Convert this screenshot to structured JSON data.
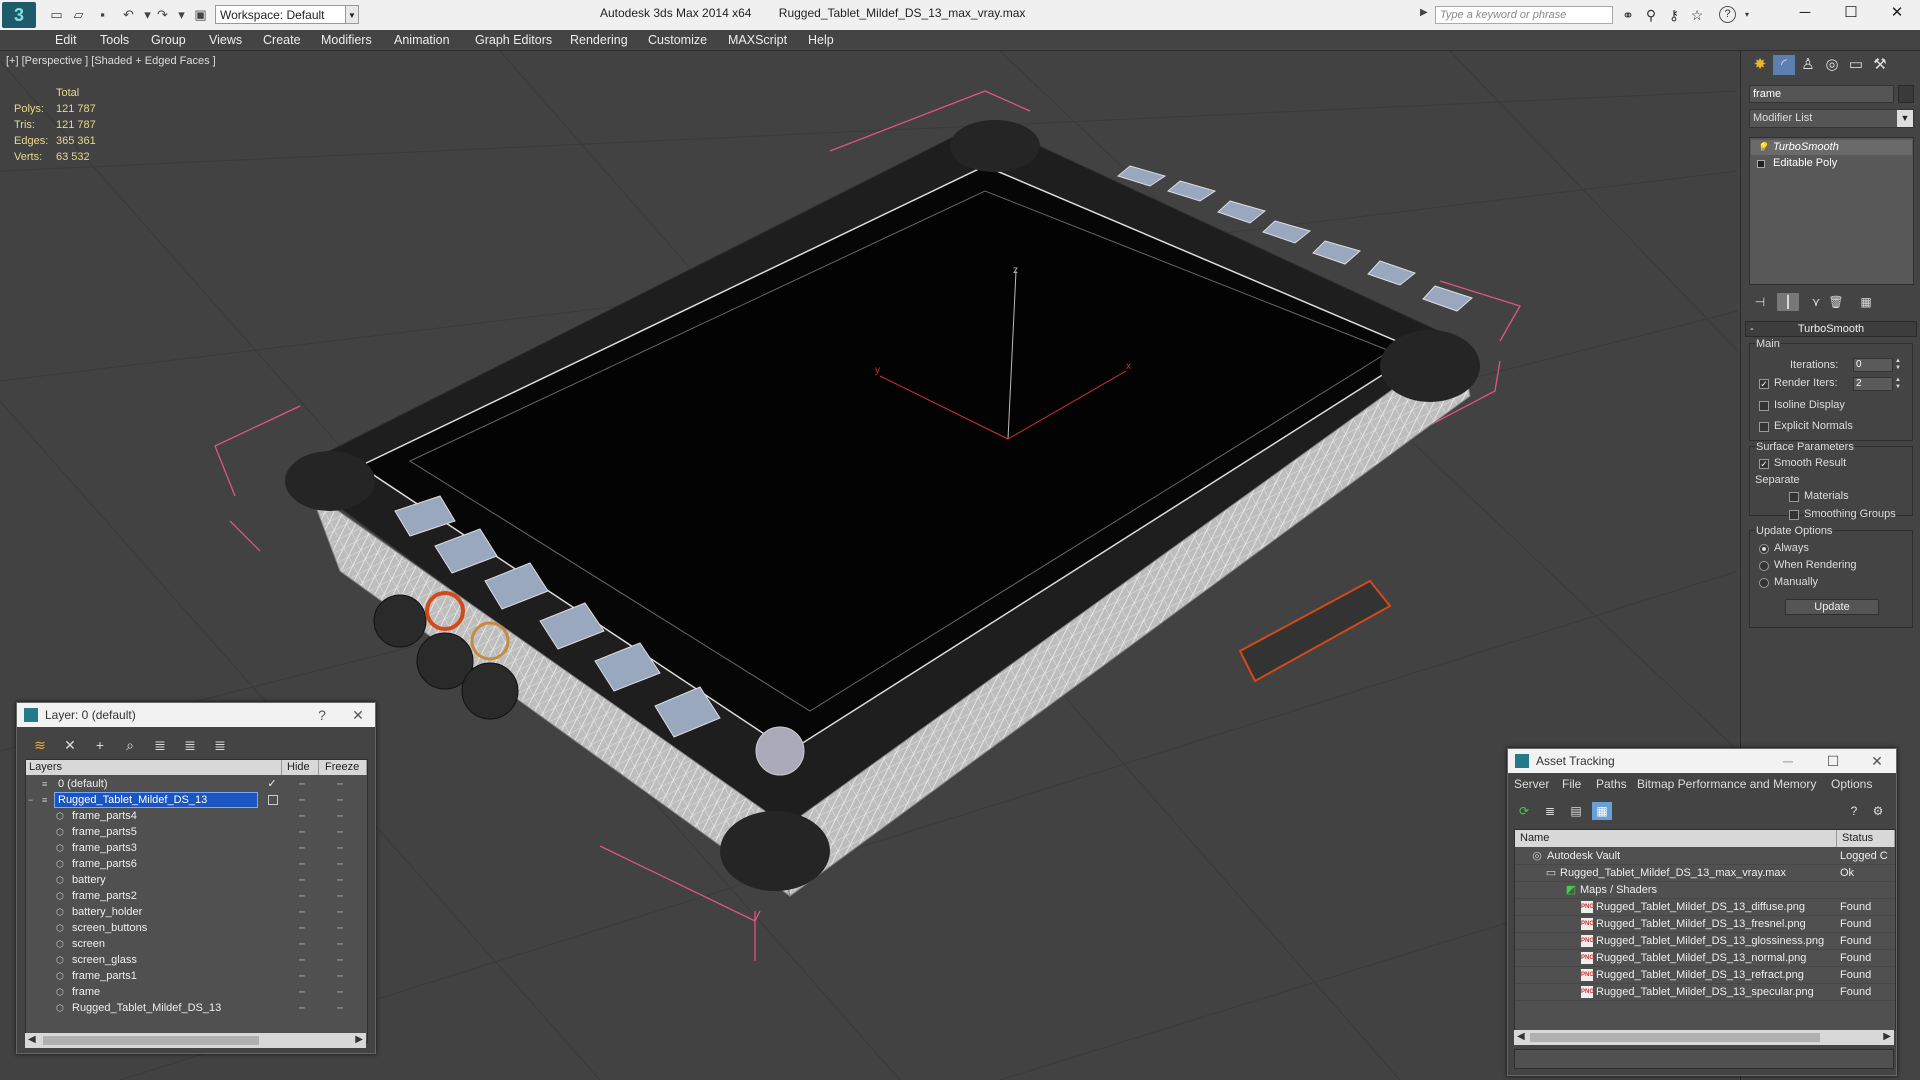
{
  "titlebar": {
    "app_name": "Autodesk 3ds Max  2014 x64",
    "file_name": "Rugged_Tablet_Mildef_DS_13_max_vray.max",
    "workspace": "Workspace: Default",
    "search_placeholder": "Type a keyword or phrase",
    "logo_glyph": "3",
    "help_glyph": "?",
    "minimize_glyph": "─",
    "maximize_glyph": "☐",
    "close_glyph": "✕"
  },
  "menu": [
    "Edit",
    "Tools",
    "Group",
    "Views",
    "Create",
    "Modifiers",
    "Animation",
    "Graph Editors",
    "Rendering",
    "Customize",
    "MAXScript",
    "Help"
  ],
  "viewport": {
    "label": "[+] [Perspective ] [Shaded + Edged Faces ]",
    "stats": {
      "header": "Total",
      "rows": [
        {
          "label": "Polys:",
          "value": "121 787"
        },
        {
          "label": "Tris:",
          "value": "121 787"
        },
        {
          "label": "Edges:",
          "value": "365 361"
        },
        {
          "label": "Verts:",
          "value": "63 532"
        }
      ]
    },
    "gizmo": {
      "x": "x",
      "y": "y",
      "z": "z"
    }
  },
  "command_panel": {
    "object_name": "frame",
    "modifier_list": "Modifier List",
    "stack": [
      {
        "label": "TurboSmooth",
        "selected": true
      },
      {
        "label": "Editable Poly",
        "selected": false
      }
    ],
    "rollout_title": "TurboSmooth",
    "main_label": "Main",
    "iterations_label": "Iterations:",
    "iterations_value": "0",
    "render_iters_label": "Render Iters:",
    "render_iters_value": "2",
    "isoline_label": "Isoline Display",
    "explicit_normals_label": "Explicit Normals",
    "surface_params_label": "Surface Parameters",
    "smooth_result_label": "Smooth Result",
    "separate_label": "Separate",
    "materials_label": "Materials",
    "smoothing_groups_label": "Smoothing Groups",
    "update_options_label": "Update Options",
    "always_label": "Always",
    "when_rendering_label": "When Rendering",
    "manually_label": "Manually",
    "update_button": "Update",
    "check_glyph": "✓"
  },
  "layer_window": {
    "title": "Layer: 0 (default)",
    "help_glyph": "?",
    "close_glyph": "✕",
    "columns": {
      "layers": "Layers",
      "hide": "Hide",
      "freeze": "Freeze"
    },
    "rows": [
      {
        "name": "0 (default)",
        "level": 1,
        "type": "layer",
        "selected": false
      },
      {
        "name": "Rugged_Tablet_Mildef_DS_13",
        "level": 1,
        "type": "layer",
        "selected": true
      },
      {
        "name": "frame_parts4",
        "level": 2,
        "type": "object",
        "selected": false
      },
      {
        "name": "frame_parts5",
        "level": 2,
        "type": "object",
        "selected": false
      },
      {
        "name": "frame_parts3",
        "level": 2,
        "type": "object",
        "selected": false
      },
      {
        "name": "frame_parts6",
        "level": 2,
        "type": "object",
        "selected": false
      },
      {
        "name": "battery",
        "level": 2,
        "type": "object",
        "selected": false
      },
      {
        "name": "frame_parts2",
        "level": 2,
        "type": "object",
        "selected": false
      },
      {
        "name": "battery_holder",
        "level": 2,
        "type": "object",
        "selected": false
      },
      {
        "name": "screen_buttons",
        "level": 2,
        "type": "object",
        "selected": false
      },
      {
        "name": "screen",
        "level": 2,
        "type": "object",
        "selected": false
      },
      {
        "name": "screen_glass",
        "level": 2,
        "type": "object",
        "selected": false
      },
      {
        "name": "frame_parts1",
        "level": 2,
        "type": "object",
        "selected": false
      },
      {
        "name": "frame",
        "level": 2,
        "type": "object",
        "selected": false
      },
      {
        "name": "Rugged_Tablet_Mildef_DS_13",
        "level": 2,
        "type": "object",
        "selected": false
      }
    ]
  },
  "asset_window": {
    "title": "Asset Tracking",
    "minimize_glyph": "─",
    "maximize_glyph": "☐",
    "close_glyph": "✕",
    "menu": [
      "Server",
      "File",
      "Paths",
      "Bitmap Performance and Memory",
      "Options"
    ],
    "columns": {
      "name": "Name",
      "status": "Status"
    },
    "rows": [
      {
        "name": "Autodesk Vault",
        "status": "Logged C",
        "level": 1,
        "icon": "vault",
        "icon_label": "◎"
      },
      {
        "name": "Rugged_Tablet_Mildef_DS_13_max_vray.max",
        "status": "Ok",
        "level": 2,
        "icon": "file",
        "icon_label": "▭"
      },
      {
        "name": "Maps / Shaders",
        "status": "",
        "level": 3,
        "icon": "maps",
        "icon_label": "◩"
      },
      {
        "name": "Rugged_Tablet_Mildef_DS_13_diffuse.png",
        "status": "Found",
        "level": 4,
        "icon": "png",
        "icon_label": "PNG"
      },
      {
        "name": "Rugged_Tablet_Mildef_DS_13_fresnel.png",
        "status": "Found",
        "level": 4,
        "icon": "png",
        "icon_label": "PNG"
      },
      {
        "name": "Rugged_Tablet_Mildef_DS_13_glossiness.png",
        "status": "Found",
        "level": 4,
        "icon": "png",
        "icon_label": "PNG"
      },
      {
        "name": "Rugged_Tablet_Mildef_DS_13_normal.png",
        "status": "Found",
        "level": 4,
        "icon": "png",
        "icon_label": "PNG"
      },
      {
        "name": "Rugged_Tablet_Mildef_DS_13_refract.png",
        "status": "Found",
        "level": 4,
        "icon": "png",
        "icon_label": "PNG"
      },
      {
        "name": "Rugged_Tablet_Mildef_DS_13_specular.png",
        "status": "Found",
        "level": 4,
        "icon": "png",
        "icon_label": "PNG"
      }
    ]
  },
  "colors": {
    "viewport_bg": "#424242",
    "selection_blue": "#1a55c0",
    "stats_text": "#e8d890",
    "bbox_pink": "#e0557f",
    "axis_red": "#d03030"
  }
}
